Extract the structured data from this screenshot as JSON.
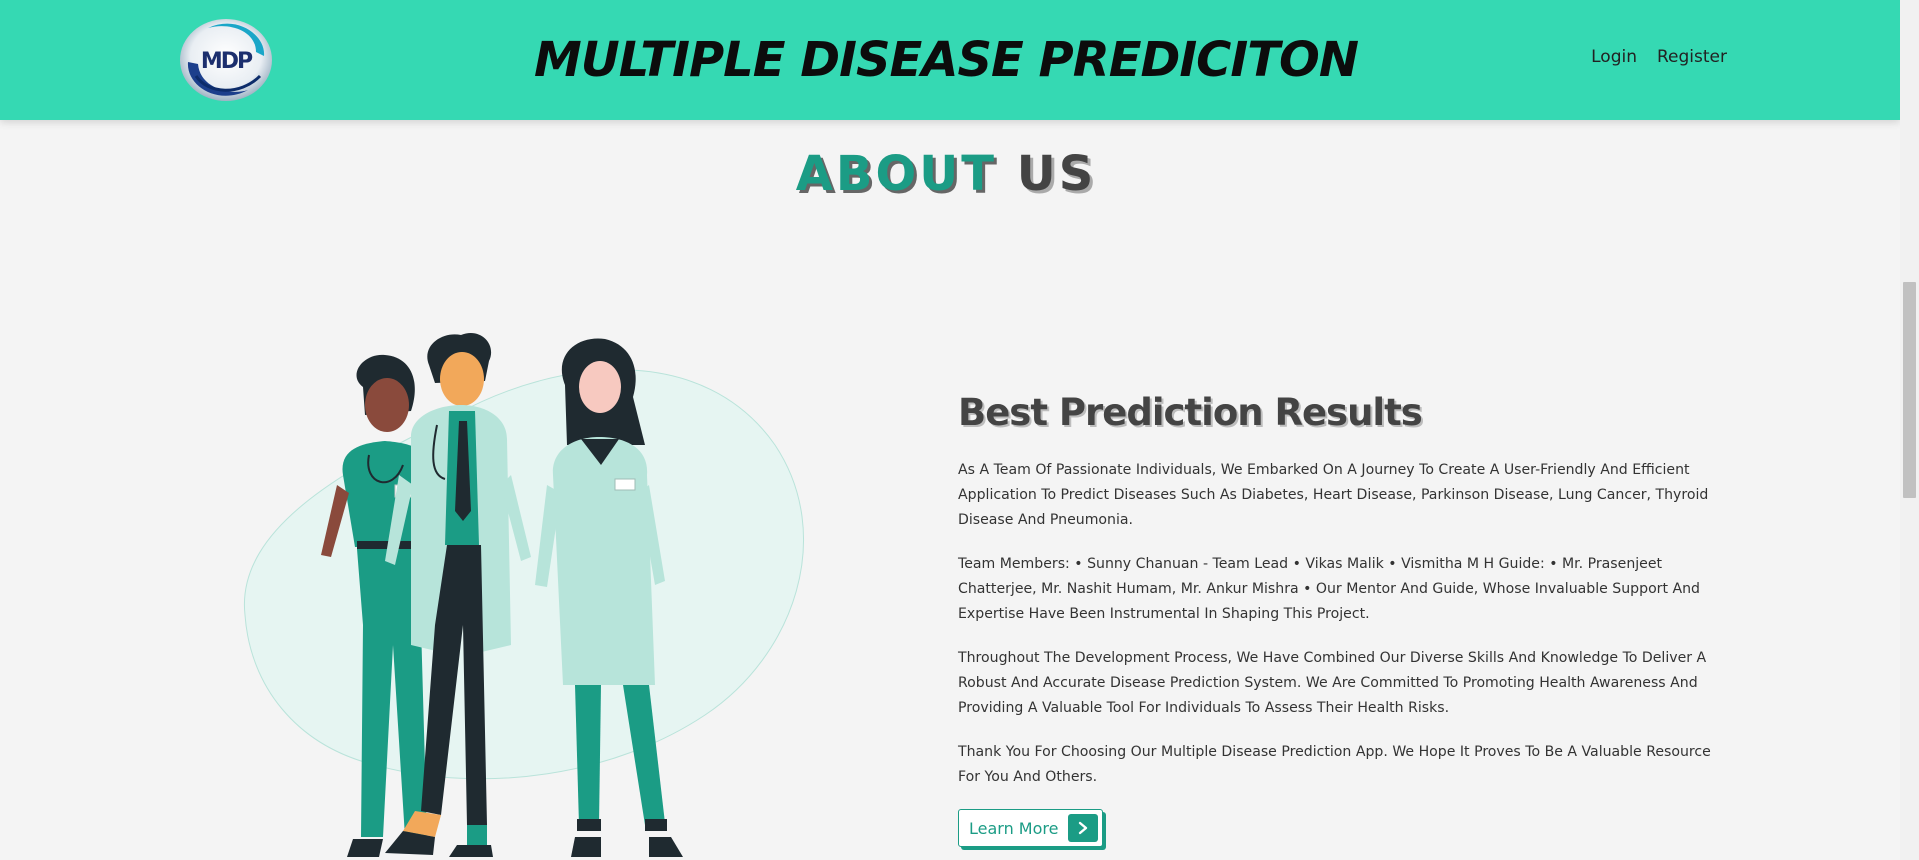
{
  "header": {
    "logo_text": "MDP",
    "title": "MULTIPLE DISEASE PREDICITON",
    "nav": {
      "login": "Login",
      "register": "Register"
    }
  },
  "about": {
    "heading_highlight": "ABOUT",
    "heading_rest": "US",
    "title": "Best Prediction Results",
    "paragraphs": [
      "As A Team Of Passionate Individuals, We Embarked On A Journey To Create A User-Friendly And Efficient Application To Predict Diseases Such As Diabetes, Heart Disease, Parkinson Disease, Lung Cancer, Thyroid Disease And Pneumonia.",
      "Team Members: • Sunny Chanuan - Team Lead • Vikas Malik • Vismitha M H Guide: • Mr. Prasenjeet Chatterjee, Mr. Nashit Humam, Mr. Ankur Mishra • Our Mentor And Guide, Whose Invaluable Support And Expertise Have Been Instrumental In Shaping This Project.",
      "Throughout The Development Process, We Have Combined Our Diverse Skills And Knowledge To Deliver A Robust And Accurate Disease Prediction System. We Are Committed To Promoting Health Awareness And Providing A Valuable Tool For Individuals To Assess Their Health Risks.",
      "Thank You For Choosing Our Multiple Disease Prediction App. We Hope It Proves To Be A Valuable Resource For You And Others."
    ],
    "button_label": "Learn More"
  },
  "colors": {
    "navbar": "#35d9b3",
    "accent": "#1b9c85",
    "page_bg": "#f4f4f4"
  },
  "icons": {
    "logo": "mdp-logo-icon",
    "button": "chevron-right-icon",
    "illustration": "medical-team-illustration"
  }
}
